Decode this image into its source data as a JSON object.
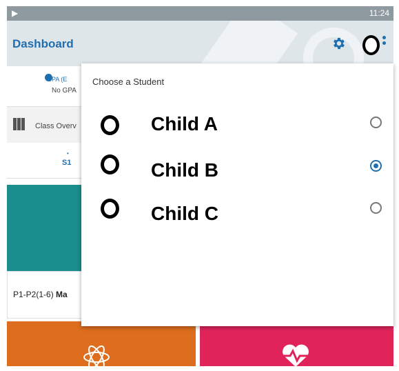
{
  "status_bar": {
    "time": "11:24",
    "play_glyph": "▶"
  },
  "app_bar": {
    "title": "Dashboard"
  },
  "background": {
    "gpa_label": "GPA (E",
    "gpa_value": "No GPA",
    "class_overview": "Class Overv",
    "tab_marker": "•",
    "tab_label": "S1",
    "card_label_prefix": "P1-P2(1-6) ",
    "card_label_bold": "Ma"
  },
  "dialog": {
    "heading": "Choose a Student",
    "options": [
      {
        "name": "Child A",
        "selected": false
      },
      {
        "name": "Child B",
        "selected": true
      },
      {
        "name": "Child C",
        "selected": false
      }
    ]
  },
  "colors": {
    "accent": "#1f6fb0",
    "teal": "#1a8e8d",
    "orange": "#de6e1e",
    "red": "#e0245a"
  }
}
